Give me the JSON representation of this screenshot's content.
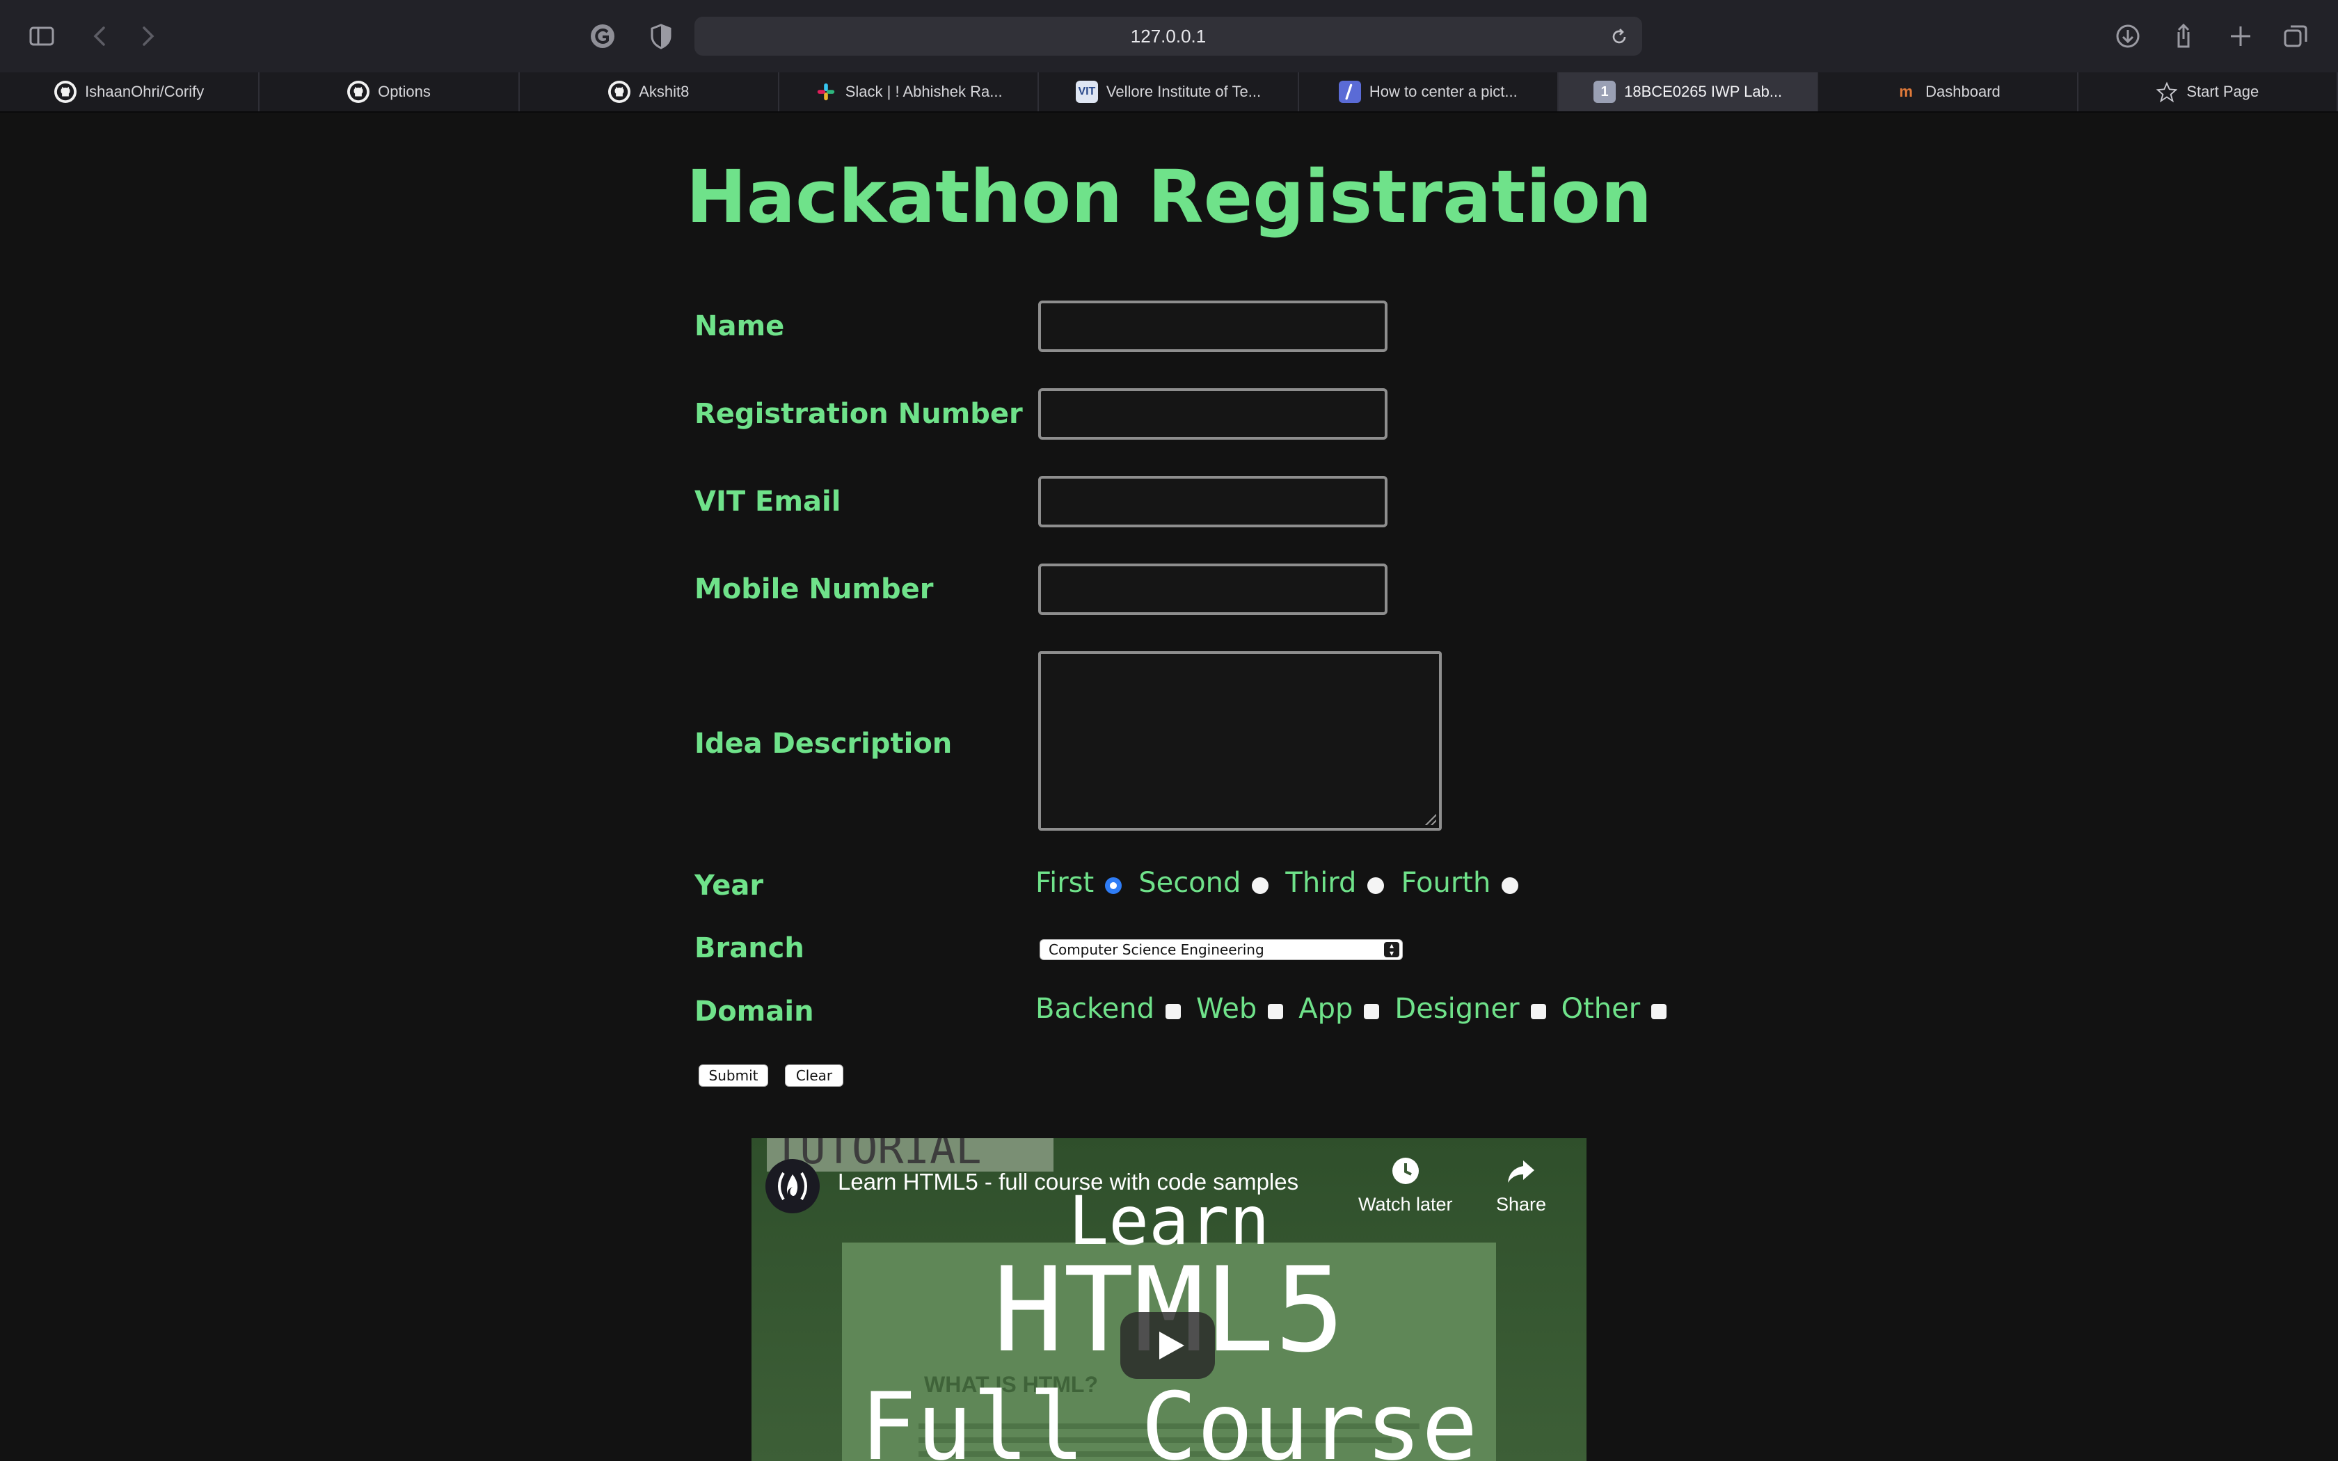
{
  "browser": {
    "url": "127.0.0.1",
    "tabs": [
      {
        "label": "IshaanOhri/Corify",
        "icon": "github-icon",
        "active": false
      },
      {
        "label": "Options",
        "icon": "github-icon",
        "active": false
      },
      {
        "label": "Akshit8",
        "icon": "github-icon",
        "active": false
      },
      {
        "label": "Slack | ! Abhishek Ra...",
        "icon": "slack-icon",
        "active": false
      },
      {
        "label": "Vellore Institute of Te...",
        "icon": "vit-icon",
        "active": false
      },
      {
        "label": "How to center a pict...",
        "icon": "stackoverflow-icon",
        "active": false
      },
      {
        "label": "18BCE0265 IWP Lab...",
        "icon": "number-icon",
        "active": true
      },
      {
        "label": "Dashboard",
        "icon": "m-icon",
        "active": false
      },
      {
        "label": "Start Page",
        "icon": "star-icon",
        "active": false
      }
    ],
    "tab_icon_glyphs": {
      "vit": "VIT",
      "number": "1",
      "m": "m"
    }
  },
  "form": {
    "title": "Hackathon Registration",
    "fields": {
      "name": {
        "label": "Name",
        "value": ""
      },
      "registration_number": {
        "label": "Registration Number",
        "value": ""
      },
      "vit_email": {
        "label": "VIT Email",
        "value": ""
      },
      "mobile_number": {
        "label": "Mobile Number",
        "value": ""
      },
      "idea_description": {
        "label": "Idea Description",
        "value": ""
      }
    },
    "year": {
      "label": "Year",
      "options": [
        "First",
        "Second",
        "Third",
        "Fourth"
      ],
      "selected": "First"
    },
    "branch": {
      "label": "Branch",
      "selected": "Computer Science Engineering"
    },
    "domain": {
      "label": "Domain",
      "options": [
        "Backend",
        "Web",
        "App",
        "Designer",
        "Other"
      ],
      "checked": []
    },
    "submit_label": "Submit",
    "clear_label": "Clear"
  },
  "video": {
    "title": "Learn HTML5 - full course with code samples",
    "watch_later_label": "Watch later",
    "share_label": "Share",
    "thumbnail_line1": "Learn",
    "thumbnail_line2": "HTML5",
    "thumbnail_line3": "Full Course",
    "tag": "TUTORIAL",
    "slide_heading": "WHAT IS HTML?"
  },
  "colors": {
    "accent": "#6fe28a",
    "background": "#121212",
    "radio_checked": "#2f7df6"
  }
}
